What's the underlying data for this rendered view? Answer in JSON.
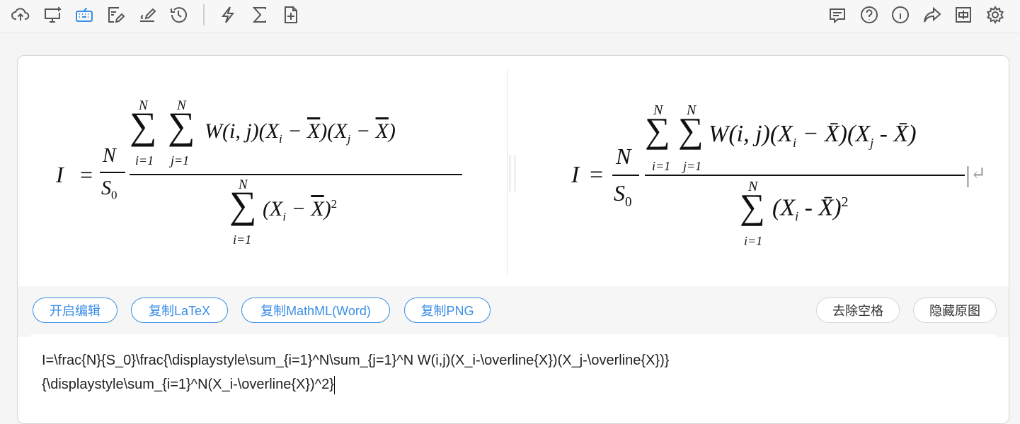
{
  "toolbar": {
    "left_icons": [
      "cloud-upload-icon",
      "monitor-add-icon",
      "keyboard-icon",
      "note-edit-icon",
      "handwriting-icon",
      "history-icon",
      "lightning-icon",
      "sigma-icon",
      "file-add-icon"
    ],
    "right_icons": [
      "chat-icon",
      "help-icon",
      "info-icon",
      "share-icon",
      "window-icon",
      "gear-icon"
    ],
    "active_color": "#3a8ee6"
  },
  "formula": {
    "lhs": "I",
    "n": "N",
    "s0_base": "S",
    "s0_sub": "0",
    "upper": "N",
    "sub_i": "i=1",
    "sub_j": "j=1",
    "term_num": "W(i, j)(X",
    "xi": "i",
    "xj": "j",
    "xbar": "X",
    "sq": "2"
  },
  "buttons": {
    "open_edit": "开启编辑",
    "copy_latex": "复制LaTeX",
    "copy_mathml": "复制MathML(Word)",
    "copy_png": "复制PNG",
    "remove_space": "去除空格",
    "hide_original": "隐藏原图"
  },
  "editor": {
    "line1": "I=\\frac{N}{S_0}\\frac{\\displaystyle\\sum_{i=1}^N\\sum_{j=1}^N W(i,j)(X_i-\\overline{X})(X_j-\\overline{X})}",
    "line2": "{\\displaystyle\\sum_{i=1}^N(X_i-\\overline{X})^2}"
  }
}
